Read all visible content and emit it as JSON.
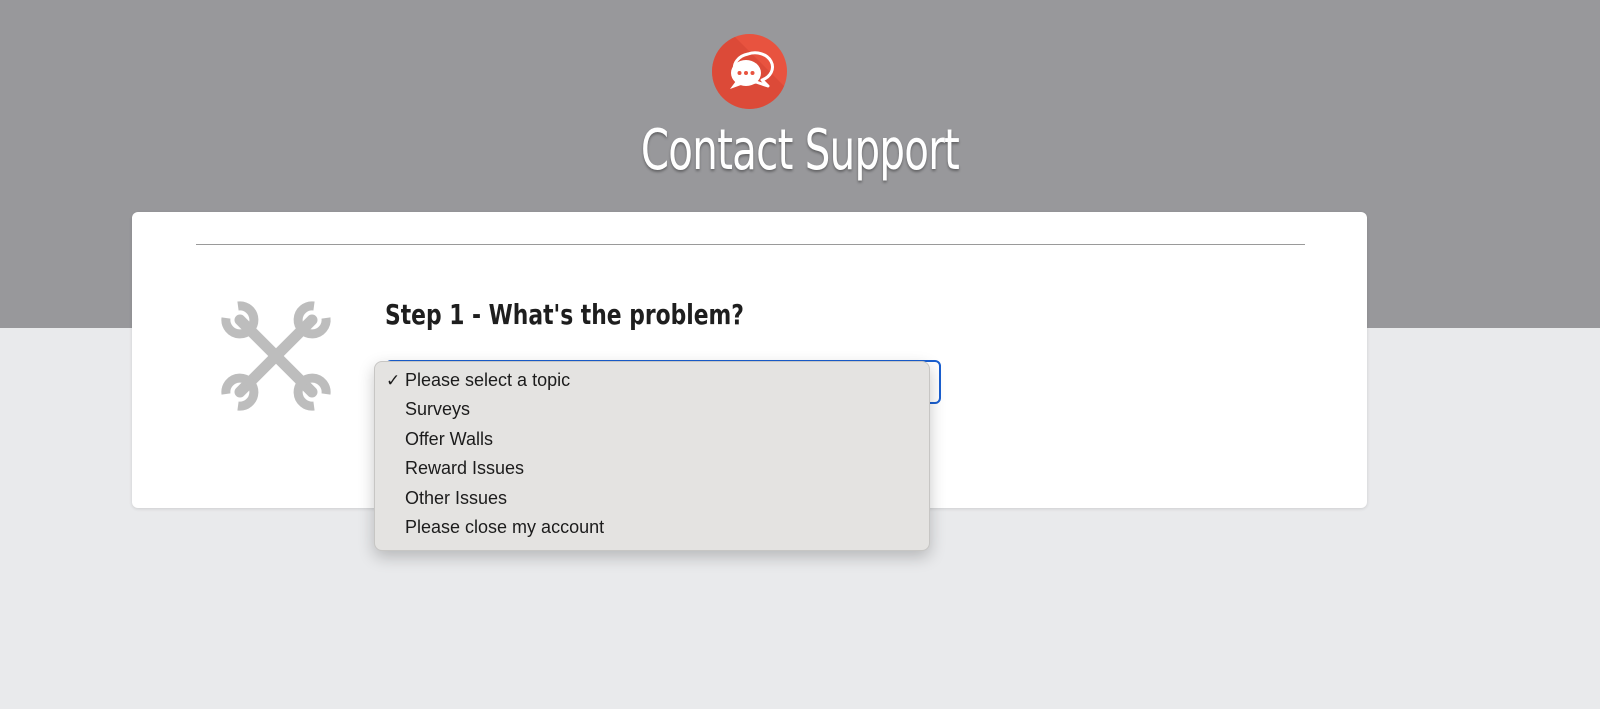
{
  "header": {
    "logo_icon": "chat-bubbles-icon",
    "title": "Contact Support",
    "band_color": "#98989b",
    "logo_color": "#e8533f"
  },
  "step": {
    "heading": "Step 1 - What's the problem?",
    "illustration_icon": "wrench-cross-icon"
  },
  "topic_select": {
    "selected_value": "Please select a topic",
    "check_mark": "✓",
    "options": [
      "Please select a topic",
      "Surveys",
      "Offer Walls",
      "Reward Issues",
      "Other Issues",
      "Please close my account"
    ],
    "focus_color": "#1a5fd0"
  }
}
